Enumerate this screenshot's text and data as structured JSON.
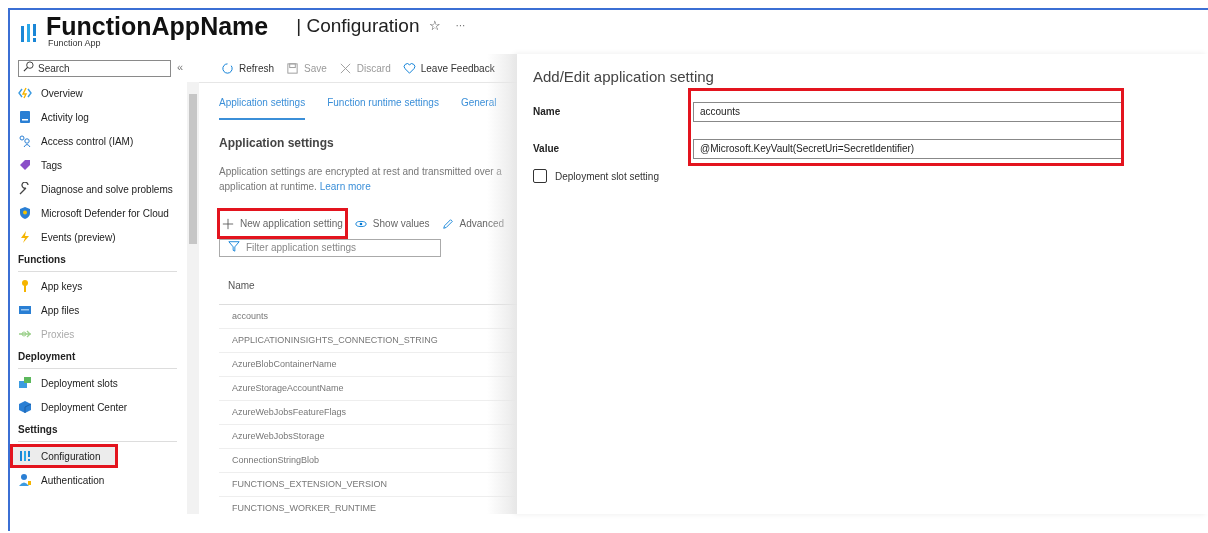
{
  "header": {
    "app_name": "FunctionAppName",
    "app_type": "Function App",
    "page_title": "| Configuration",
    "favorite_glyph": "☆",
    "more_glyph": "···"
  },
  "sidebar": {
    "search": {
      "placeholder": "Search"
    },
    "collapse_glyph": "«",
    "sections": [
      {
        "items": [
          {
            "label": "Overview",
            "selected": false,
            "disabled": false,
            "highlighted": false
          },
          {
            "label": "Activity log",
            "selected": false,
            "disabled": false,
            "highlighted": false
          },
          {
            "label": "Access control (IAM)",
            "selected": false,
            "disabled": false,
            "highlighted": false
          },
          {
            "label": "Tags",
            "selected": false,
            "disabled": false,
            "highlighted": false
          },
          {
            "label": "Diagnose and solve problems",
            "selected": false,
            "disabled": false,
            "highlighted": false
          },
          {
            "label": "Microsoft Defender for Cloud",
            "selected": false,
            "disabled": false,
            "highlighted": false
          },
          {
            "label": "Events (preview)",
            "selected": false,
            "disabled": false,
            "highlighted": false
          }
        ]
      },
      {
        "title": "Functions",
        "items": [
          {
            "label": "App keys",
            "selected": false,
            "disabled": false,
            "highlighted": false
          },
          {
            "label": "App files",
            "selected": false,
            "disabled": false,
            "highlighted": false
          },
          {
            "label": "Proxies",
            "selected": false,
            "disabled": true,
            "highlighted": false
          }
        ]
      },
      {
        "title": "Deployment",
        "items": [
          {
            "label": "Deployment slots",
            "selected": false,
            "disabled": false,
            "highlighted": false
          },
          {
            "label": "Deployment Center",
            "selected": false,
            "disabled": false,
            "highlighted": false
          }
        ]
      },
      {
        "title": "Settings",
        "items": [
          {
            "label": "Configuration",
            "selected": true,
            "disabled": false,
            "highlighted": true
          },
          {
            "label": "Authentication",
            "selected": false,
            "disabled": false,
            "highlighted": false
          }
        ]
      }
    ]
  },
  "toolbar": [
    {
      "label": "Refresh",
      "disabled": false
    },
    {
      "label": "Save",
      "disabled": true
    },
    {
      "label": "Discard",
      "disabled": true
    },
    {
      "label": "Leave Feedback",
      "disabled": false
    }
  ],
  "tabs": [
    {
      "label": "Application settings",
      "selected": true
    },
    {
      "label": "Function runtime settings",
      "selected": false
    },
    {
      "label": "General",
      "selected": false
    }
  ],
  "section": {
    "title": "Application settings",
    "description_line_1": "Application settings are encrypted at rest and transmitted over a",
    "description_line_2": "application at runtime.",
    "link": "Learn more"
  },
  "actions": [
    {
      "label": "New application setting",
      "highlighted": true
    },
    {
      "label": "Show values",
      "highlighted": false
    },
    {
      "label": "Advanced",
      "highlighted": false
    }
  ],
  "filter": {
    "placeholder": "Filter application settings"
  },
  "table": {
    "columns": [
      "Name"
    ],
    "rows": [
      "accounts",
      "APPLICATIONINSIGHTS_CONNECTION_STRING",
      "AzureBlobContainerName",
      "AzureStorageAccountName",
      "AzureWebJobsFeatureFlags",
      "AzureWebJobsStorage",
      "ConnectionStringBlob",
      "FUNCTIONS_EXTENSION_VERSION",
      "FUNCTIONS_WORKER_RUNTIME"
    ]
  },
  "panel": {
    "title": "Add/Edit application setting",
    "fields_highlighted": true,
    "fields": [
      {
        "label": "Name",
        "value": "accounts"
      },
      {
        "label": "Value",
        "value": "@Microsoft.KeyVault(SecretUri=SecretIdentifier)"
      }
    ],
    "slot_setting": {
      "label": "Deployment slot setting",
      "checked": false
    }
  }
}
